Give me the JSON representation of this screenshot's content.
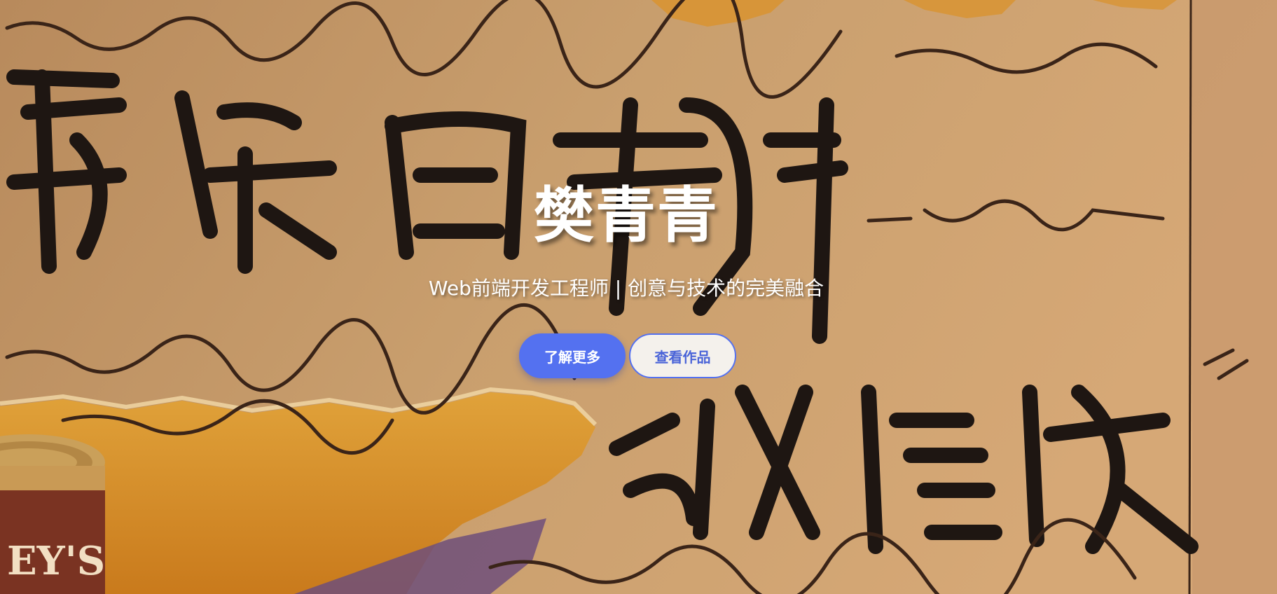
{
  "hero": {
    "title": "樊青青",
    "subtitle": "Web前端开发工程师 | 创意与技术的完美融合",
    "buttons": {
      "primary_label": "了解更多",
      "secondary_label": "查看作品"
    },
    "background_image": "handwritten-calligraphy-poster",
    "colors": {
      "primary": "#5471f0",
      "secondary_bg": "#f4f1ec",
      "title_text": "#ffffff"
    }
  }
}
